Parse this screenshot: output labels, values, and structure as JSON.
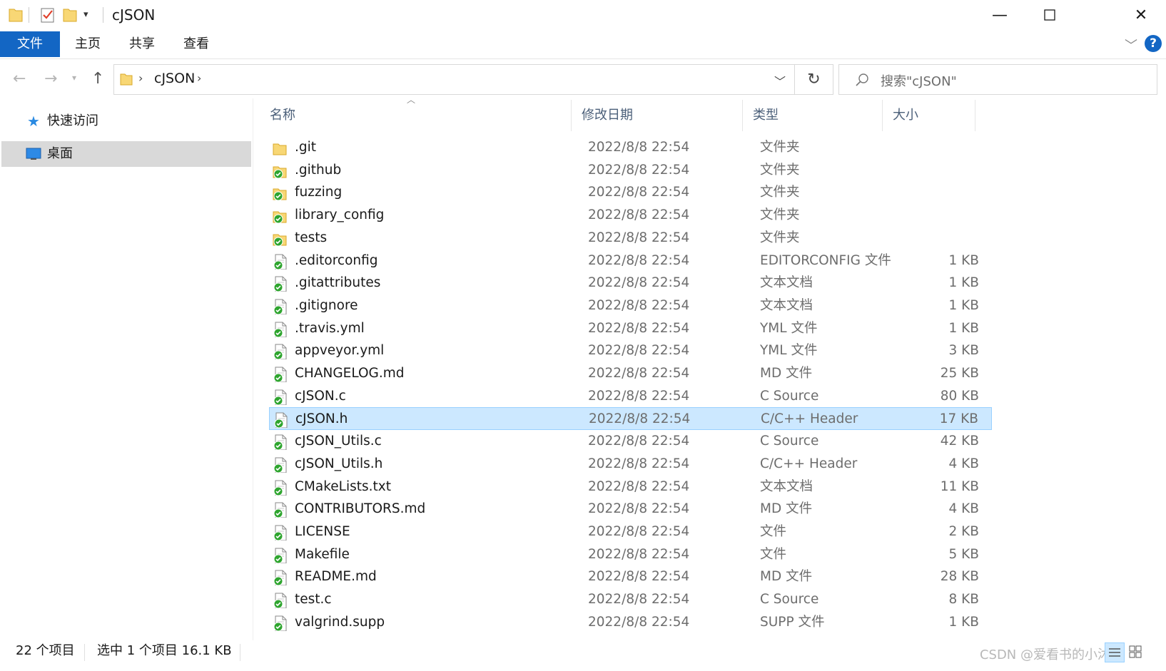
{
  "window": {
    "title": "cJSON",
    "minimize_glyph": "—",
    "maximize_glyph": "☐",
    "close_glyph": "✕"
  },
  "ribbon": {
    "tabs": [
      "文件",
      "主页",
      "共享",
      "查看"
    ],
    "help_glyph": "?"
  },
  "address": {
    "path": "cJSON",
    "search_placeholder": "搜索\"cJSON\""
  },
  "sidebar": {
    "items": [
      {
        "label": "快速访问",
        "icon": "star-icon"
      },
      {
        "label": "桌面",
        "icon": "desktop-icon"
      }
    ]
  },
  "columns": {
    "name": "名称",
    "date": "修改日期",
    "type": "类型",
    "size": "大小"
  },
  "files": [
    {
      "name": ".git",
      "date": "2022/8/8 22:54",
      "type": "文件夹",
      "size": "",
      "kind": "folder"
    },
    {
      "name": ".github",
      "date": "2022/8/8 22:54",
      "type": "文件夹",
      "size": "",
      "kind": "folder-synced"
    },
    {
      "name": "fuzzing",
      "date": "2022/8/8 22:54",
      "type": "文件夹",
      "size": "",
      "kind": "folder-synced"
    },
    {
      "name": "library_config",
      "date": "2022/8/8 22:54",
      "type": "文件夹",
      "size": "",
      "kind": "folder-synced"
    },
    {
      "name": "tests",
      "date": "2022/8/8 22:54",
      "type": "文件夹",
      "size": "",
      "kind": "folder-synced"
    },
    {
      "name": ".editorconfig",
      "date": "2022/8/8 22:54",
      "type": "EDITORCONFIG 文件",
      "size": "1 KB",
      "kind": "file-synced"
    },
    {
      "name": ".gitattributes",
      "date": "2022/8/8 22:54",
      "type": "文本文档",
      "size": "1 KB",
      "kind": "file-synced"
    },
    {
      "name": ".gitignore",
      "date": "2022/8/8 22:54",
      "type": "文本文档",
      "size": "1 KB",
      "kind": "file-synced"
    },
    {
      "name": ".travis.yml",
      "date": "2022/8/8 22:54",
      "type": "YML 文件",
      "size": "1 KB",
      "kind": "file-synced"
    },
    {
      "name": "appveyor.yml",
      "date": "2022/8/8 22:54",
      "type": "YML 文件",
      "size": "3 KB",
      "kind": "file-synced"
    },
    {
      "name": "CHANGELOG.md",
      "date": "2022/8/8 22:54",
      "type": "MD 文件",
      "size": "25 KB",
      "kind": "file-synced"
    },
    {
      "name": "cJSON.c",
      "date": "2022/8/8 22:54",
      "type": "C Source",
      "size": "80 KB",
      "kind": "file-synced"
    },
    {
      "name": "cJSON.h",
      "date": "2022/8/8 22:54",
      "type": "C/C++ Header",
      "size": "17 KB",
      "kind": "file-synced",
      "selected": true
    },
    {
      "name": "cJSON_Utils.c",
      "date": "2022/8/8 22:54",
      "type": "C Source",
      "size": "42 KB",
      "kind": "file-synced"
    },
    {
      "name": "cJSON_Utils.h",
      "date": "2022/8/8 22:54",
      "type": "C/C++ Header",
      "size": "4 KB",
      "kind": "file-synced"
    },
    {
      "name": "CMakeLists.txt",
      "date": "2022/8/8 22:54",
      "type": "文本文档",
      "size": "11 KB",
      "kind": "file-synced"
    },
    {
      "name": "CONTRIBUTORS.md",
      "date": "2022/8/8 22:54",
      "type": "MD 文件",
      "size": "4 KB",
      "kind": "file-synced"
    },
    {
      "name": "LICENSE",
      "date": "2022/8/8 22:54",
      "type": "文件",
      "size": "2 KB",
      "kind": "file-synced"
    },
    {
      "name": "Makefile",
      "date": "2022/8/8 22:54",
      "type": "文件",
      "size": "5 KB",
      "kind": "file-synced"
    },
    {
      "name": "README.md",
      "date": "2022/8/8 22:54",
      "type": "MD 文件",
      "size": "28 KB",
      "kind": "file-synced"
    },
    {
      "name": "test.c",
      "date": "2022/8/8 22:54",
      "type": "C Source",
      "size": "8 KB",
      "kind": "file-synced"
    },
    {
      "name": "valgrind.supp",
      "date": "2022/8/8 22:54",
      "type": "SUPP 文件",
      "size": "1 KB",
      "kind": "file-synced"
    }
  ],
  "status": {
    "count": "22 个项目",
    "selection": "选中 1 个项目  16.1 KB"
  },
  "watermark": "CSDN @爱看书的小沐",
  "colors": {
    "accent": "#1366c4",
    "selected_row": "#cce8ff",
    "selected_border": "#99d1ff",
    "folder": "#f8d775",
    "sync_green": "#2fa52f"
  }
}
